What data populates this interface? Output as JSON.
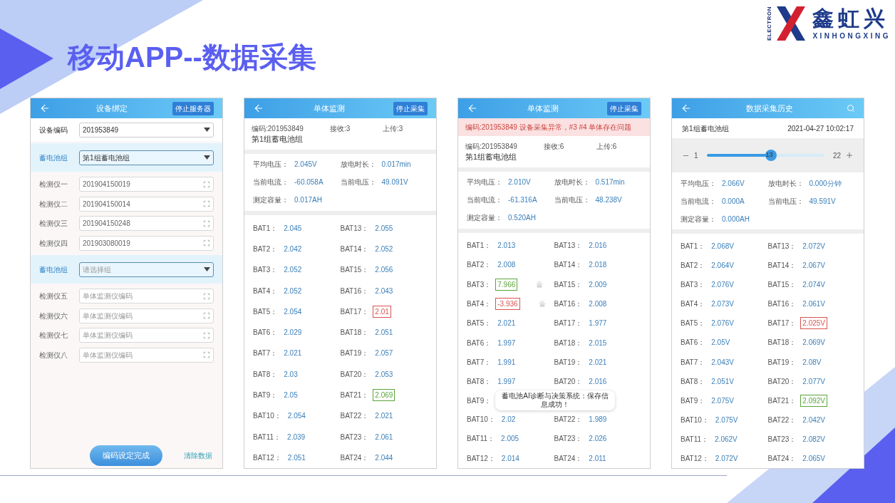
{
  "slide_title": "移动APP--数据采集",
  "logo": {
    "vertical": "ELECTRON",
    "brand": "鑫虹兴",
    "latin": "XINHONGXING"
  },
  "screens": [
    {
      "kind": "binding",
      "title": "设备绑定",
      "action": "停止服务器",
      "rows": [
        {
          "kind": "select",
          "label": "设备编码",
          "value": "201953849",
          "band": false
        },
        {
          "kind": "select",
          "label": "蓄电池组",
          "value": "第1组蓄电池组",
          "band": true
        },
        {
          "kind": "scan",
          "label": "检测仪一",
          "value": "201904150019"
        },
        {
          "kind": "scan",
          "label": "检测仪二",
          "value": "201904150014"
        },
        {
          "kind": "scan",
          "label": "检测仪三",
          "value": "201904150248"
        },
        {
          "kind": "scan",
          "label": "检测仪四",
          "value": "201903080019"
        },
        {
          "kind": "select",
          "label": "蓄电池组",
          "placeholder": "请选择组",
          "band": true
        },
        {
          "kind": "scan",
          "label": "检测仪五",
          "placeholder": "单体监测仪编码"
        },
        {
          "kind": "scan",
          "label": "检测仪六",
          "placeholder": "单体监测仪编码"
        },
        {
          "kind": "scan",
          "label": "检测仪七",
          "placeholder": "单体监测仪编码"
        },
        {
          "kind": "scan",
          "label": "检测仪八",
          "placeholder": "单体监测仪编码"
        }
      ],
      "submit": "编码设定完成",
      "clear": "清除数据"
    },
    {
      "kind": "monitor",
      "title": "单体监测",
      "action": "停止采集",
      "code": "编码:201953849",
      "received": "接收:3",
      "uploaded": "上传:3",
      "group": "第1组蓄电池组",
      "stats": [
        {
          "label": "平均电压：",
          "value": "2.045V"
        },
        {
          "label": "放电时长：",
          "value": "0.017min"
        },
        {
          "label": "当前电流：",
          "value": "-60.058A"
        },
        {
          "label": "当前电压：",
          "value": "49.091V"
        },
        {
          "label": "测定容量：",
          "value": "0.017AH"
        }
      ],
      "rows": [
        {
          "left": {
            "label": "BAT1：",
            "value": "2.045",
            "boxed": false
          },
          "right": {
            "label": "BAT13：",
            "value": "2.055",
            "boxed": false
          }
        },
        {
          "left": {
            "label": "BAT2：",
            "value": "2.042",
            "boxed": false
          },
          "right": {
            "label": "BAT14：",
            "value": "2.052",
            "boxed": false
          }
        },
        {
          "left": {
            "label": "BAT3：",
            "value": "2.052",
            "boxed": false
          },
          "right": {
            "label": "BAT15：",
            "value": "2.056",
            "boxed": false
          }
        },
        {
          "left": {
            "label": "BAT4：",
            "value": "2.052",
            "boxed": false
          },
          "right": {
            "label": "BAT16：",
            "value": "2.043",
            "boxed": false
          }
        },
        {
          "left": {
            "label": "BAT5：",
            "value": "2.054",
            "boxed": false
          },
          "right": {
            "label": "BAT17：",
            "value": "2.01",
            "boxed": true,
            "color": "#d9534f"
          }
        },
        {
          "left": {
            "label": "BAT6：",
            "value": "2.029",
            "boxed": false
          },
          "right": {
            "label": "BAT18：",
            "value": "2.051",
            "boxed": false
          }
        },
        {
          "left": {
            "label": "BAT7：",
            "value": "2.021",
            "boxed": false
          },
          "right": {
            "label": "BAT19：",
            "value": "2.057",
            "boxed": false
          }
        },
        {
          "left": {
            "label": "BAT8：",
            "value": "2.03",
            "boxed": false
          },
          "right": {
            "label": "BAT20：",
            "value": "2.053",
            "boxed": false
          }
        },
        {
          "left": {
            "label": "BAT9：",
            "value": "2.05",
            "boxed": false
          },
          "right": {
            "label": "BAT21：",
            "value": "2.069",
            "boxed": true,
            "color": "#5aa43a"
          }
        },
        {
          "left": {
            "label": "BAT10：",
            "value": "2.054",
            "boxed": false
          },
          "right": {
            "label": "BAT22：",
            "value": "2.021",
            "boxed": false
          }
        },
        {
          "left": {
            "label": "BAT11：",
            "value": "2.039",
            "boxed": false
          },
          "right": {
            "label": "BAT23：",
            "value": "2.061",
            "boxed": false
          }
        },
        {
          "left": {
            "label": "BAT12：",
            "value": "2.051",
            "boxed": false
          },
          "right": {
            "label": "BAT24：",
            "value": "2.044",
            "boxed": false
          }
        }
      ]
    },
    {
      "kind": "monitor",
      "title": "单体监测",
      "action": "停止采集",
      "alert": "编码:201953849 设备采集异常，#3 #4 单体存在问题",
      "code": "编码:201953849",
      "received": "接收:6",
      "uploaded": "上传:6",
      "group": "第1组蓄电池组",
      "stats": [
        {
          "label": "平均电压：",
          "value": "2.010V"
        },
        {
          "label": "放电时长：",
          "value": "0.517min"
        },
        {
          "label": "当前电流：",
          "value": "-61.316A"
        },
        {
          "label": "当前电压：",
          "value": "48.238V"
        },
        {
          "label": "测定容量：",
          "value": "0.520AH"
        }
      ],
      "rows": [
        {
          "left": {
            "label": "BAT1：",
            "value": "2.013",
            "boxed": false,
            "alarm": false
          },
          "right": {
            "label": "BAT13：",
            "value": "2.016",
            "boxed": false,
            "alarm": false
          }
        },
        {
          "left": {
            "label": "BAT2：",
            "value": "2.008",
            "boxed": false,
            "alarm": false
          },
          "right": {
            "label": "BAT14：",
            "value": "2.018",
            "boxed": false,
            "alarm": false
          }
        },
        {
          "left": {
            "label": "BAT3：",
            "value": "7.966",
            "boxed": true,
            "color": "#5aa43a",
            "alarm": true
          },
          "right": {
            "label": "BAT15：",
            "value": "2.009",
            "boxed": false,
            "alarm": false
          }
        },
        {
          "left": {
            "label": "BAT4：",
            "value": "-3.936",
            "boxed": true,
            "color": "#d9534f",
            "alarm": true
          },
          "right": {
            "label": "BAT16：",
            "value": "2.008",
            "boxed": false,
            "alarm": false
          }
        },
        {
          "left": {
            "label": "BAT5：",
            "value": "2.021",
            "boxed": false,
            "alarm": false
          },
          "right": {
            "label": "BAT17：",
            "value": "1.977",
            "boxed": false,
            "alarm": false
          }
        },
        {
          "left": {
            "label": "BAT6：",
            "value": "1.997",
            "boxed": false,
            "alarm": false
          },
          "right": {
            "label": "BAT18：",
            "value": "2.015",
            "boxed": false,
            "alarm": false
          }
        },
        {
          "left": {
            "label": "BAT7：",
            "value": "1.991",
            "boxed": false,
            "alarm": false
          },
          "right": {
            "label": "BAT19：",
            "value": "2.021",
            "boxed": false,
            "alarm": false
          }
        },
        {
          "left": {
            "label": "BAT8：",
            "value": "1.997",
            "boxed": false,
            "alarm": false
          },
          "right": {
            "label": "BAT20：",
            "value": "2.016",
            "boxed": false,
            "alarm": false
          }
        },
        {
          "left": {
            "label": "BAT9："
          }
        },
        {
          "left": {
            "label": "BAT10：",
            "value": "2.02",
            "boxed": false,
            "alarm": false
          },
          "right": {
            "label": "BAT22：",
            "value": "1.989",
            "boxed": false,
            "alarm": false
          }
        },
        {
          "left": {
            "label": "BAT11：",
            "value": "2.005",
            "boxed": false,
            "alarm": false
          },
          "right": {
            "label": "BAT23：",
            "value": "2.026",
            "boxed": false,
            "alarm": false
          }
        },
        {
          "left": {
            "label": "BAT12：",
            "value": "2.014",
            "boxed": false,
            "alarm": false
          },
          "right": {
            "label": "BAT24：",
            "value": "2.011",
            "boxed": false,
            "alarm": false
          }
        }
      ],
      "toast": "蓄电池AI诊断与决策系统：保存信息成功！"
    },
    {
      "kind": "history",
      "title": "数据采集历史",
      "group": "第1组蓄电池组",
      "time": "2021-04-27 10:02:17",
      "slider": {
        "min": "1",
        "max": "22",
        "current": "13",
        "level": 0.55
      },
      "stats": [
        {
          "label": "平均电压：",
          "value": "2.066V"
        },
        {
          "label": "放电时长：",
          "value": "0.000分钟"
        },
        {
          "label": "当前电流：",
          "value": "0.000A"
        },
        {
          "label": "当前电压：",
          "value": "49.591V"
        },
        {
          "label": "测定容量：",
          "value": "0.000AH"
        }
      ],
      "rows": [
        {
          "left": {
            "label": "BAT1：",
            "value": "2.068V",
            "boxed": false
          },
          "right": {
            "label": "BAT13：",
            "value": "2.072V",
            "boxed": false
          }
        },
        {
          "left": {
            "label": "BAT2：",
            "value": "2.064V",
            "boxed": false
          },
          "right": {
            "label": "BAT14：",
            "value": "2.067V",
            "boxed": false
          }
        },
        {
          "left": {
            "label": "BAT3：",
            "value": "2.076V",
            "boxed": false
          },
          "right": {
            "label": "BAT15：",
            "value": "2.074V",
            "boxed": false
          }
        },
        {
          "left": {
            "label": "BAT4：",
            "value": "2.073V",
            "boxed": false
          },
          "right": {
            "label": "BAT16：",
            "value": "2.061V",
            "boxed": false
          }
        },
        {
          "left": {
            "label": "BAT5：",
            "value": "2.076V",
            "boxed": false
          },
          "right": {
            "label": "BAT17：",
            "value": "2.025V",
            "boxed": true,
            "color": "#d9534f"
          }
        },
        {
          "left": {
            "label": "BAT6：",
            "value": "2.05V",
            "boxed": false
          },
          "right": {
            "label": "BAT18：",
            "value": "2.069V",
            "boxed": false
          }
        },
        {
          "left": {
            "label": "BAT7：",
            "value": "2.043V",
            "boxed": false
          },
          "right": {
            "label": "BAT19：",
            "value": "2.08V",
            "boxed": false
          }
        },
        {
          "left": {
            "label": "BAT8：",
            "value": "2.051V",
            "boxed": false
          },
          "right": {
            "label": "BAT20：",
            "value": "2.077V",
            "boxed": false
          }
        },
        {
          "left": {
            "label": "BAT9：",
            "value": "2.075V",
            "boxed": false
          },
          "right": {
            "label": "BAT21：",
            "value": "2.092V",
            "boxed": true,
            "color": "#5aa43a"
          }
        },
        {
          "left": {
            "label": "BAT10：",
            "value": "2.075V",
            "boxed": false
          },
          "right": {
            "label": "BAT22：",
            "value": "2.042V",
            "boxed": false
          }
        },
        {
          "left": {
            "label": "BAT11：",
            "value": "2.062V",
            "boxed": false
          },
          "right": {
            "label": "BAT23：",
            "value": "2.082V",
            "boxed": false
          }
        },
        {
          "left": {
            "label": "BAT12：",
            "value": "2.072V",
            "boxed": false
          },
          "right": {
            "label": "BAT24：",
            "value": "2.065V",
            "boxed": false
          }
        }
      ]
    }
  ]
}
